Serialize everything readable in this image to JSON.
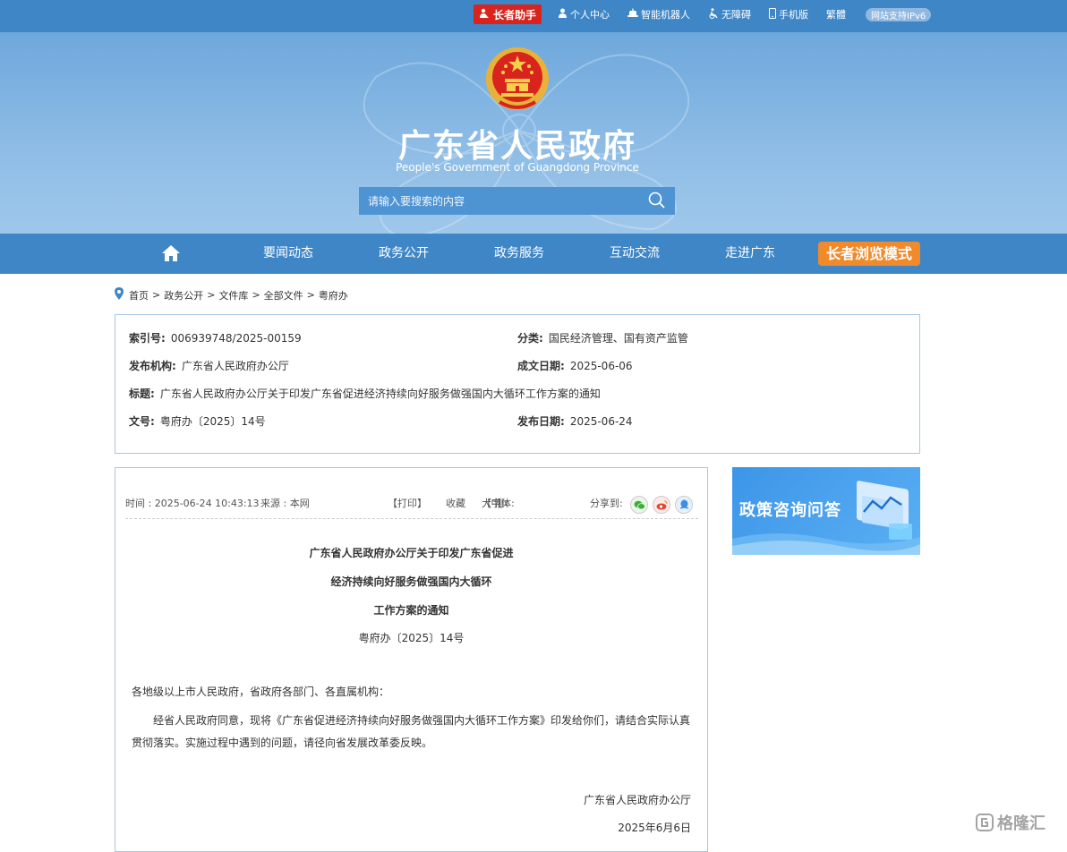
{
  "topbar": {
    "elder_helper": "长者助手",
    "links": [
      "个人中心",
      "智能机器人",
      "无障碍",
      "手机版",
      "繁體"
    ],
    "ipv6": "网站支持IPv6"
  },
  "header": {
    "title": "广东省人民政府",
    "subtitle": "People's Government of Guangdong Province",
    "search_placeholder": "请输入要搜索的内容"
  },
  "nav": {
    "items": [
      "要闻动态",
      "政务公开",
      "政务服务",
      "互动交流",
      "走进广东"
    ],
    "elder_mode": "长者浏览模式"
  },
  "breadcrumb": [
    "首页",
    "政务公开",
    "文件库",
    "全部文件",
    "粤府办"
  ],
  "meta": {
    "index_label": "索引号:",
    "index_value": "006939748/2025-00159",
    "category_label": "分类:",
    "category_value": "国民经济管理、国有资产监管",
    "publisher_label": "发布机构:",
    "publisher_value": "广东省人民政府办公厅",
    "written_label": "成文日期:",
    "written_value": "2025-06-06",
    "title_label": "标题:",
    "title_value": "广东省人民政府办公厅关于印发广东省促进经济持续向好服务做强国内大循环工作方案的通知",
    "docno_label": "文号:",
    "docno_value": "粤府办〔2025〕14号",
    "published_label": "发布日期:",
    "published_value": "2025-06-24"
  },
  "article": {
    "time": "时间 : 2025-06-24 10:43:13",
    "source": "来源 : 本网",
    "print": "【打印】",
    "favorite": "收藏",
    "font_label": "【字体:",
    "font_large": "大",
    "font_medium": "中",
    "font_small": "小",
    "font_end": "】",
    "share": "分享到:",
    "title_lines": [
      "广东省人民政府办公厅关于印发广东省促进",
      "经济持续向好服务做强国内大循环",
      "工作方案的通知"
    ],
    "doc_no": "粤府办〔2025〕14号",
    "salutation": "各地级以上市人民政府，省政府各部门、各直属机构：",
    "body_line1": "经省人民政府同意，现将《广东省促进经济持续向好服务做强国内大循环工作方案》印发给你们，请结合实际认真",
    "body_line2": "贯彻落实。实施过程中遇到的问题，请径向省发展改革委反映。",
    "sign_org": "广东省人民政府办公厅",
    "sign_date": "2025年6月6日"
  },
  "promo": {
    "text": "政策咨询问答"
  },
  "watermark": "格隆汇",
  "colors": {
    "primary": "#3f86c7",
    "elder_red": "#d8241c",
    "elder_orange": "#f08a2b",
    "border": "#a7c7e7"
  }
}
